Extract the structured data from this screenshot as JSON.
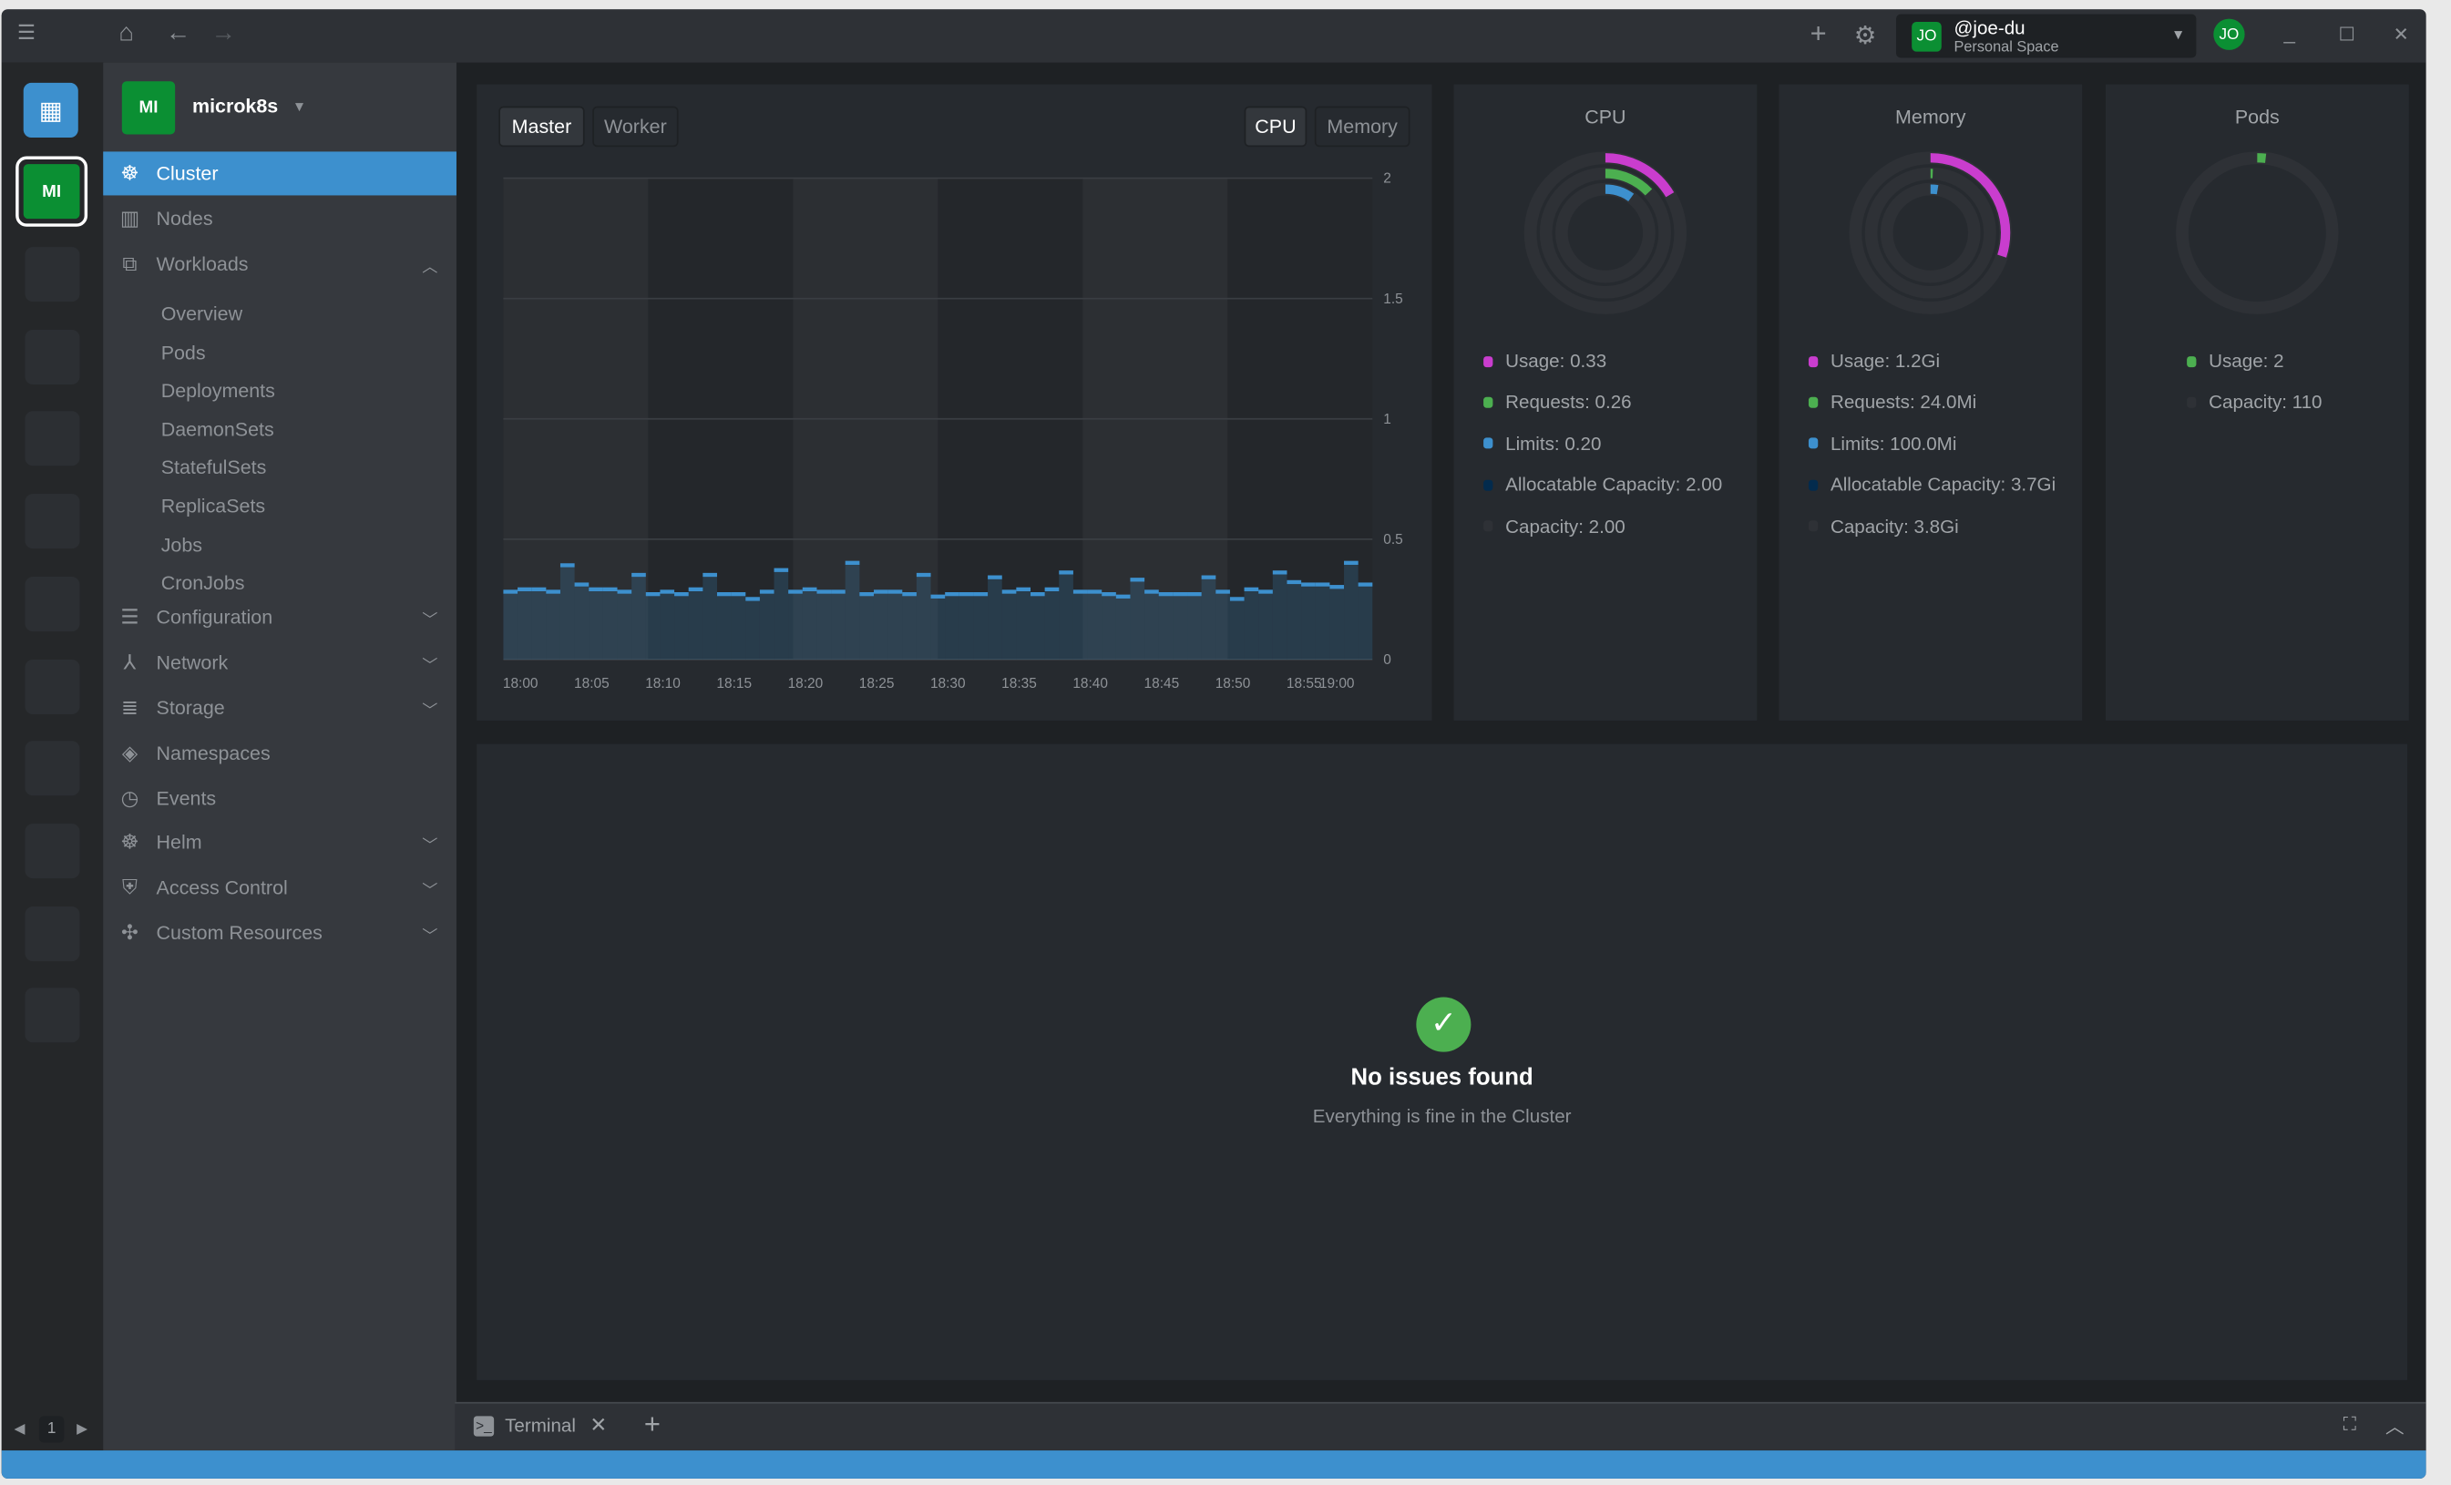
{
  "topbar": {
    "user_name": "@joe-du",
    "user_space": "Personal Space",
    "user_initials": "JO",
    "avatar_initials": "JO"
  },
  "hotbar": {
    "cluster_initials": "MI",
    "page": "1"
  },
  "sidebar": {
    "cluster_name": "microk8s",
    "cluster_initials": "MI",
    "items": [
      {
        "label": "Cluster",
        "icon": "helm-wheel-icon",
        "active": true
      },
      {
        "label": "Nodes",
        "icon": "nodes-icon"
      },
      {
        "label": "Workloads",
        "icon": "workloads-icon",
        "expanded": true
      },
      {
        "label": "Configuration",
        "icon": "list-icon"
      },
      {
        "label": "Network",
        "icon": "network-icon"
      },
      {
        "label": "Storage",
        "icon": "database-icon"
      },
      {
        "label": "Namespaces",
        "icon": "layers-icon"
      },
      {
        "label": "Events",
        "icon": "clock-icon"
      },
      {
        "label": "Helm",
        "icon": "helm-icon"
      },
      {
        "label": "Access Control",
        "icon": "shield-icon"
      },
      {
        "label": "Custom Resources",
        "icon": "puzzle-icon"
      }
    ],
    "workloads": [
      "Overview",
      "Pods",
      "Deployments",
      "DaemonSets",
      "StatefulSets",
      "ReplicaSets",
      "Jobs",
      "CronJobs"
    ]
  },
  "chart": {
    "tabs": [
      "Master",
      "Worker"
    ],
    "metric_tabs": [
      "CPU",
      "Memory"
    ],
    "active_tab": "Master",
    "active_metric": "CPU"
  },
  "chart_data": {
    "type": "bar",
    "ylim": [
      0,
      2
    ],
    "yticks": [
      "2",
      "1.5",
      "1",
      "0.5",
      "0"
    ],
    "xticks": [
      "18:00",
      "18:05",
      "18:10",
      "18:15",
      "18:20",
      "18:25",
      "18:30",
      "18:35",
      "18:40",
      "18:45",
      "18:50",
      "18:55",
      "19:00"
    ],
    "values": [
      0.29,
      0.3,
      0.3,
      0.29,
      0.4,
      0.32,
      0.3,
      0.3,
      0.29,
      0.36,
      0.28,
      0.29,
      0.28,
      0.3,
      0.36,
      0.28,
      0.28,
      0.26,
      0.29,
      0.38,
      0.29,
      0.3,
      0.29,
      0.29,
      0.41,
      0.28,
      0.29,
      0.29,
      0.28,
      0.36,
      0.27,
      0.28,
      0.28,
      0.28,
      0.35,
      0.29,
      0.3,
      0.28,
      0.3,
      0.37,
      0.29,
      0.29,
      0.28,
      0.27,
      0.34,
      0.29,
      0.28,
      0.28,
      0.28,
      0.35,
      0.29,
      0.26,
      0.3,
      0.29,
      0.37,
      0.33,
      0.32,
      0.32,
      0.31,
      0.41,
      0.32
    ],
    "color": "#3d90ce"
  },
  "metrics": [
    {
      "title": "CPU",
      "rings": [
        {
          "pct": 0.165,
          "color": "#c93dce"
        },
        {
          "pct": 0.13,
          "color": "#4caf50"
        },
        {
          "pct": 0.1,
          "color": "#3d90ce"
        }
      ],
      "legend": [
        {
          "text": "Usage: 0.33",
          "color": "#c93dce"
        },
        {
          "text": "Requests: 0.26",
          "color": "#4caf50"
        },
        {
          "text": "Limits: 0.20",
          "color": "#3d90ce"
        },
        {
          "text": "Allocatable Capacity: 2.00",
          "color": "#032b4d"
        },
        {
          "text": "Capacity: 2.00",
          "color": "#2e3136"
        }
      ]
    },
    {
      "title": "Memory",
      "rings": [
        {
          "pct": 0.3,
          "color": "#c93dce"
        },
        {
          "pct": 0.006,
          "color": "#4caf50"
        },
        {
          "pct": 0.026,
          "color": "#3d90ce"
        }
      ],
      "legend": [
        {
          "text": "Usage: 1.2Gi",
          "color": "#c93dce"
        },
        {
          "text": "Requests: 24.0Mi",
          "color": "#4caf50"
        },
        {
          "text": "Limits: 100.0Mi",
          "color": "#3d90ce"
        },
        {
          "text": "Allocatable Capacity: 3.7Gi",
          "color": "#032b4d"
        },
        {
          "text": "Capacity: 3.8Gi",
          "color": "#2e3136"
        }
      ]
    },
    {
      "title": "Pods",
      "rings": [
        {
          "pct": 0.018,
          "color": "#4caf50"
        }
      ],
      "legend": [
        {
          "text": "Usage: 2",
          "color": "#4caf50"
        },
        {
          "text": "Capacity: 110",
          "color": "#2e3136"
        }
      ]
    }
  ],
  "issues": {
    "title": "No issues found",
    "subtitle": "Everything is fine in the Cluster"
  },
  "dock": {
    "tab_label": "Terminal"
  }
}
